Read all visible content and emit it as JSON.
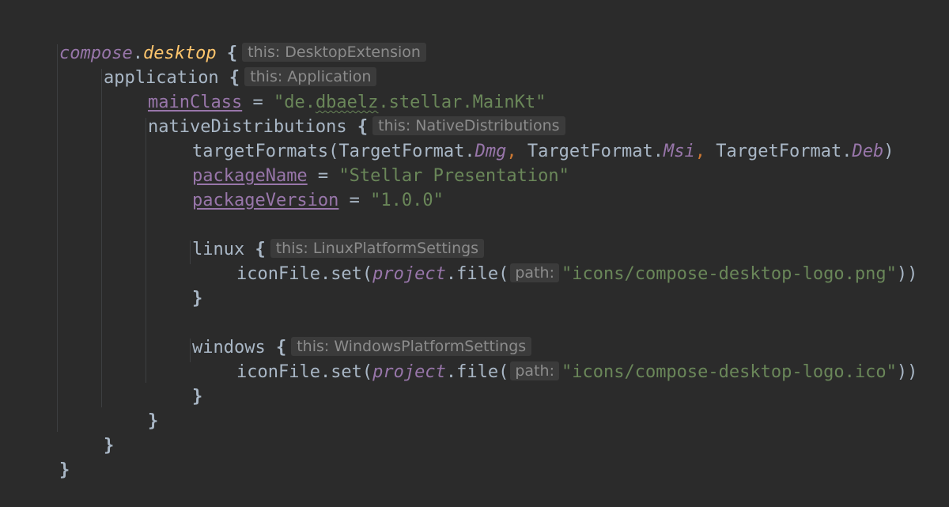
{
  "code": {
    "l1": {
      "obj": "compose",
      "dot": ".",
      "member": "desktop",
      "brace": " {",
      "hint": "this: DesktopExtension"
    },
    "l2": {
      "name": "application",
      "brace": " {",
      "hint": "this: Application"
    },
    "l3": {
      "prop": "mainClass",
      "eq": " = ",
      "q1": "\"de.",
      "squiggle": "dbaelz",
      "q2": ".stellar.MainKt\""
    },
    "l4": {
      "name": "nativeDistributions",
      "brace": " {",
      "hint": "this: NativeDistributions"
    },
    "l5": {
      "fn": "targetFormats(TargetFormat.",
      "a": "Dmg",
      "c1": ",",
      "mid1": " TargetFormat.",
      "b": "Msi",
      "c2": ",",
      "mid2": " TargetFormat.",
      "c": "Deb",
      "close": ")"
    },
    "l6": {
      "prop": "packageName",
      "eq": " = ",
      "val": "\"Stellar Presentation\""
    },
    "l7": {
      "prop": "packageVersion",
      "eq": " = ",
      "val": "\"1.0.0\""
    },
    "l8": {
      "name": "linux",
      "brace": " {",
      "hint": "this: LinuxPlatformSettings"
    },
    "l9": {
      "call": "iconFile.set(",
      "proj": "project",
      "file": ".file(",
      "hint": "path:",
      "val": "\"icons/compose-desktop-logo.png\"",
      "close": "))"
    },
    "l10": {
      "brace": "}"
    },
    "l11": {
      "name": "windows",
      "brace": " {",
      "hint": "this: WindowsPlatformSettings"
    },
    "l12": {
      "call": "iconFile.set(",
      "proj": "project",
      "file": ".file(",
      "hint": "path:",
      "val": "\"icons/compose-desktop-logo.ico\"",
      "close": "))"
    },
    "l13": {
      "brace": "}"
    },
    "l14": {
      "brace": "}"
    },
    "l15": {
      "brace": "}"
    },
    "l16": {
      "brace": "}"
    }
  }
}
